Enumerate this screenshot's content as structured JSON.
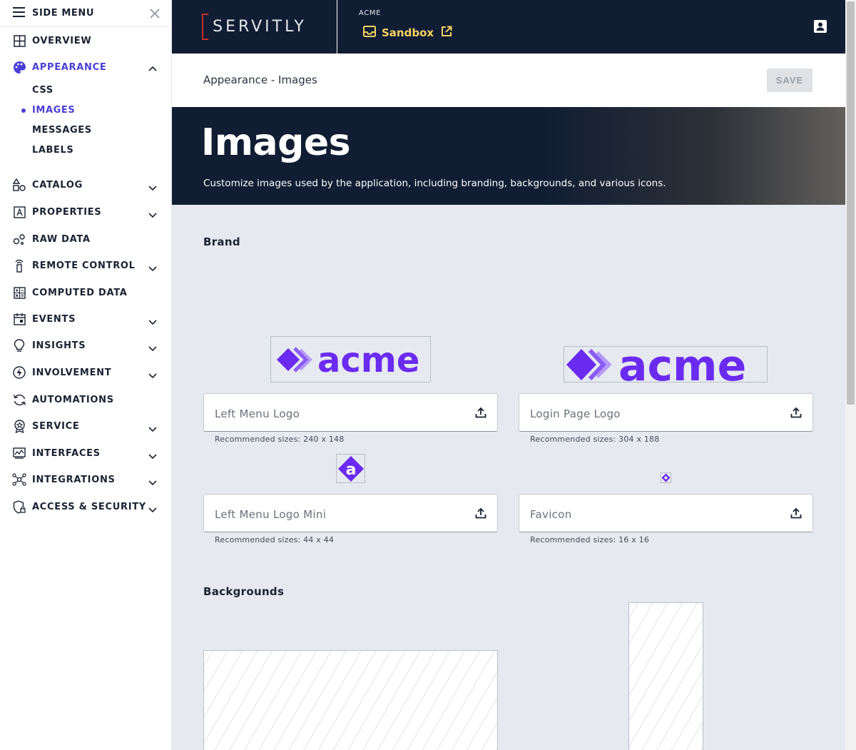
{
  "sidebar": {
    "title": "SIDE MENU",
    "items": [
      {
        "label": "OVERVIEW"
      },
      {
        "label": "APPEARANCE",
        "subitems": [
          {
            "label": "CSS"
          },
          {
            "label": "IMAGES"
          },
          {
            "label": "MESSAGES"
          },
          {
            "label": "LABELS"
          }
        ]
      },
      {
        "label": "CATALOG"
      },
      {
        "label": "PROPERTIES"
      },
      {
        "label": "RAW DATA"
      },
      {
        "label": "REMOTE CONTROL"
      },
      {
        "label": "COMPUTED DATA"
      },
      {
        "label": "EVENTS"
      },
      {
        "label": "INSIGHTS"
      },
      {
        "label": "INVOLVEMENT"
      },
      {
        "label": "AUTOMATIONS"
      },
      {
        "label": "SERVICE"
      },
      {
        "label": "INTERFACES"
      },
      {
        "label": "INTEGRATIONS"
      },
      {
        "label": "ACCESS & SECURITY"
      }
    ]
  },
  "topbar": {
    "brand": "SERVITLY",
    "tenant": "ACME",
    "environment": "Sandbox"
  },
  "header": {
    "breadcrumb": "Appearance - Images",
    "save_label": "SAVE"
  },
  "hero": {
    "title": "Images",
    "subtitle": "Customize images used by the application, including branding, backgrounds, and various icons."
  },
  "sections": {
    "brand": {
      "title": "Brand",
      "fields": [
        {
          "label": "Left Menu Logo",
          "hint": "Recommended sizes: 240 x 148"
        },
        {
          "label": "Login Page Logo",
          "hint": "Recommended sizes: 304 x 188"
        },
        {
          "label": "Left Menu Logo Mini",
          "hint": "Recommended sizes: 44 x 44"
        },
        {
          "label": "Favicon",
          "hint": "Recommended sizes: 16 x 16"
        }
      ],
      "logo_word": "acme",
      "mini_letter": "a"
    },
    "backgrounds": {
      "title": "Backgrounds"
    }
  },
  "colors": {
    "accent": "#4a3fd6",
    "brand_purple": "#6a2bf0",
    "navy": "#101d33",
    "environment": "#f4d163"
  }
}
